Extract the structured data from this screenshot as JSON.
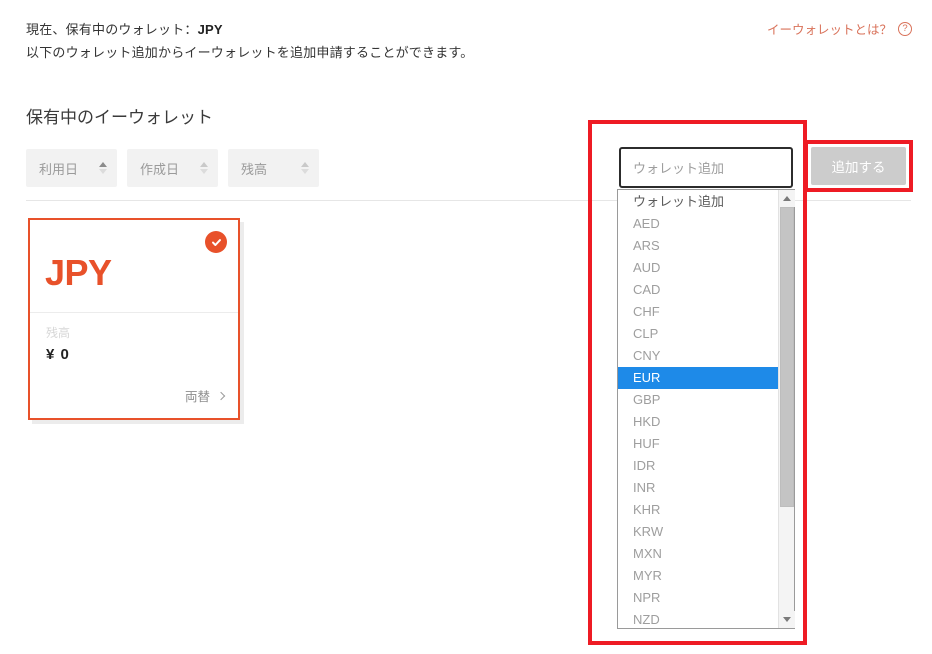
{
  "header": {
    "current_wallet_prefix": "現在、保有中のウォレット：",
    "current_wallet_currency": "JPY",
    "description": "以下のウォレット追加からイーウォレットを追加申請することができます。",
    "help_link_label": "イーウォレットとは？",
    "help_icon_glyph": "?"
  },
  "section": {
    "title": "保有中のイーウォレット"
  },
  "sort_buttons": [
    {
      "label": "利用日",
      "active": true
    },
    {
      "label": "作成日",
      "active": false
    },
    {
      "label": "残高",
      "active": false
    }
  ],
  "wallet_card": {
    "currency": "JPY",
    "selected": true,
    "balance_label": "残高",
    "balance_value": "¥ 0",
    "exchange_label": "両替",
    "border_color": "#e8512a",
    "accent_color": "#e8512a",
    "badge_icon": "check-circle-icon"
  },
  "add_wallet": {
    "select_value": "ウォレット追加",
    "select_placeholder": "ウォレット追加",
    "add_button_label": "追加する",
    "add_button_disabled": true,
    "add_button_color": "#cccccc"
  },
  "dropdown": {
    "open": true,
    "selected_option": "EUR",
    "highlight_color": "#1e8ae8",
    "options": [
      "ウォレット追加",
      "AED",
      "ARS",
      "AUD",
      "CAD",
      "CHF",
      "CLP",
      "CNY",
      "EUR",
      "GBP",
      "HKD",
      "HUF",
      "IDR",
      "INR",
      "KHR",
      "KRW",
      "MXN",
      "MYR",
      "NPR",
      "NZD"
    ],
    "scrollbar": {
      "up_arrow_glyph": "▲",
      "down_arrow_glyph": "▼"
    }
  },
  "annotations": {
    "color": "#ee1b24",
    "boxes": [
      {
        "name": "dropdown-highlight"
      },
      {
        "name": "add-button-highlight"
      }
    ]
  }
}
